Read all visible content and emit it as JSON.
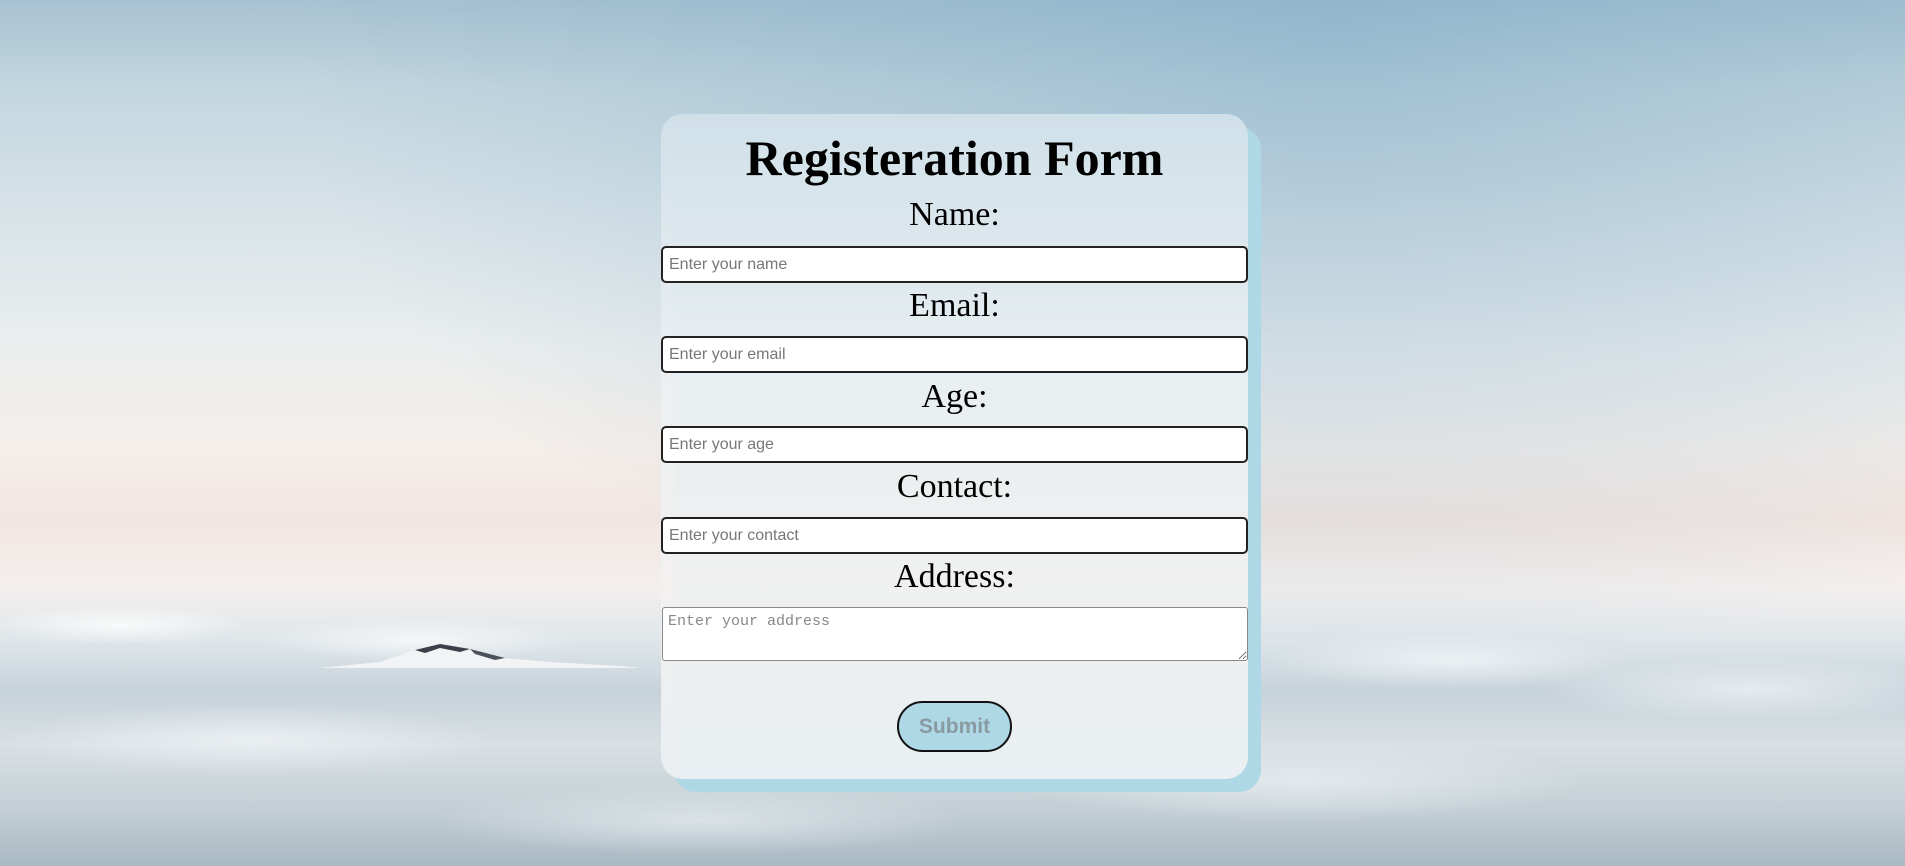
{
  "form": {
    "title": "Registeration Form",
    "fields": [
      {
        "label": "Name:",
        "placeholder": "Enter your name",
        "value": ""
      },
      {
        "label": "Email:",
        "placeholder": "Enter your email",
        "value": ""
      },
      {
        "label": "Age:",
        "placeholder": "Enter your age",
        "value": ""
      },
      {
        "label": "Contact:",
        "placeholder": "Enter your contact",
        "value": ""
      }
    ],
    "address": {
      "label": "Address:",
      "placeholder": "Enter your address",
      "value": ""
    },
    "submit_label": "Submit"
  },
  "colors": {
    "accent": "#aed8e6",
    "field_border": "#222222",
    "submit_text": "#8a9aa2"
  }
}
